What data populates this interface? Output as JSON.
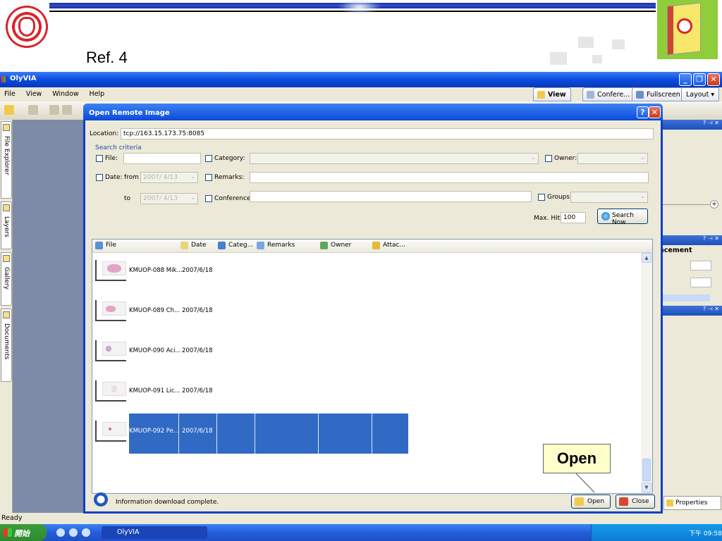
{
  "slide": {
    "ref_label": "Ref. 4",
    "callout_label": "Open"
  },
  "app": {
    "title": "OlyVIA",
    "menu": [
      "File",
      "View",
      "Window",
      "Help"
    ],
    "view_tabs": [
      "View",
      "Confere...",
      "Fullscreen",
      "Layout"
    ],
    "rail_tabs": [
      "File Explorer",
      "Layers",
      "Gallery",
      "Documents"
    ],
    "right_panel": {
      "enhancement_label": "ncement",
      "properties_tab": "Properties"
    },
    "status": "Ready"
  },
  "dialog": {
    "title": "Open Remote Image",
    "location_label": "Location:",
    "location_value": "tcp://163.15.173.75:8085",
    "search_criteria_label": "Search criteria",
    "file_label": "File:",
    "category_label": "Category:",
    "owner_label": "Owner:",
    "date_label": "Date:",
    "from_label": "from",
    "to_label": "to",
    "date_from": "2007/ 4/13",
    "date_to": "2007/ 4/13",
    "remarks_label": "Remarks:",
    "conference_label": "Conference:",
    "groups_label": "Groups:",
    "max_hits_label": "Max. Hits:",
    "max_hits_value": "100",
    "search_button": "Search Now",
    "columns": [
      "File",
      "Date",
      "Categ...",
      "Remarks",
      "Owner",
      "Attac..."
    ],
    "rows": [
      {
        "name": "KMUOP-088 Mik...",
        "date": "2007/6/18"
      },
      {
        "name": "KMUOP-089 Ch...",
        "date": "2007/6/18"
      },
      {
        "name": "KMUOP-090 Aci...",
        "date": "2007/6/18"
      },
      {
        "name": "KMUOP-091 Lic...",
        "date": "2007/6/18"
      },
      {
        "name": "KMUOP-092 Pe...",
        "date": "2007/6/18"
      }
    ],
    "status_text": "Information download complete.",
    "open_button": "Open",
    "close_button": "Close"
  },
  "taskbar": {
    "start_label": "開始",
    "task_label": "OlyVIA",
    "clock": "下午 09:58"
  },
  "colors": {
    "title_blue": "#0a4ce0",
    "selection": "#316ac5",
    "callout_bg": "#ffffcc"
  }
}
